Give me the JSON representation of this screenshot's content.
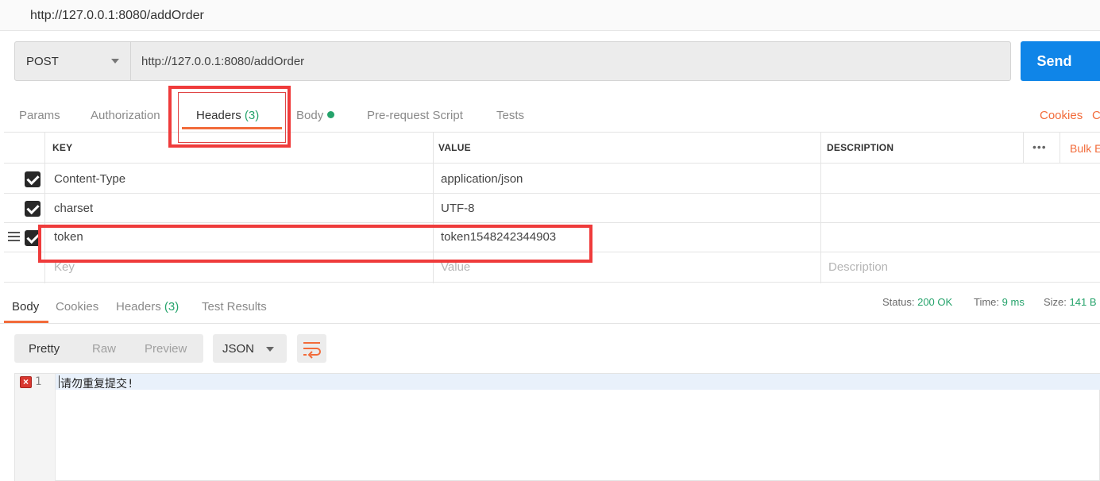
{
  "window": {
    "title": "http://127.0.0.1:8080/addOrder"
  },
  "request": {
    "method": "POST",
    "url": "http://127.0.0.1:8080/addOrder",
    "send_label": "Send"
  },
  "request_tabs": {
    "params": "Params",
    "authorization": "Authorization",
    "headers": "Headers",
    "headers_count": "(3)",
    "body": "Body",
    "prerequest": "Pre-request Script",
    "tests": "Tests",
    "cookies": "Cookies",
    "code": "Code"
  },
  "headers_table": {
    "columns": {
      "key": "KEY",
      "value": "VALUE",
      "description": "DESCRIPTION"
    },
    "bulk_edit": "Bulk Edit",
    "more": "•••",
    "rows": [
      {
        "key": "Content-Type",
        "value": "application/json",
        "enabled": true
      },
      {
        "key": "charset",
        "value": "UTF-8",
        "enabled": true
      },
      {
        "key": "token",
        "value": "token1548242344903",
        "enabled": true
      }
    ],
    "placeholders": {
      "key": "Key",
      "value": "Value",
      "description": "Description"
    }
  },
  "response_tabs": {
    "body": "Body",
    "cookies": "Cookies",
    "headers": "Headers",
    "headers_count": "(3)",
    "test_results": "Test Results"
  },
  "response_status": {
    "status_label": "Status:",
    "status_value": "200 OK",
    "time_label": "Time:",
    "time_value": "9 ms",
    "size_label": "Size:",
    "size_value": "141 B"
  },
  "response_view": {
    "pretty": "Pretty",
    "raw": "Raw",
    "preview": "Preview",
    "format": "JSON"
  },
  "editor": {
    "line_number": "1",
    "content": "请勿重复提交!",
    "error_marker": "×"
  },
  "colors": {
    "accent": "#f26b3a",
    "send": "#0f85e8",
    "success": "#25a36b",
    "highlight": "#ef3b3b"
  }
}
